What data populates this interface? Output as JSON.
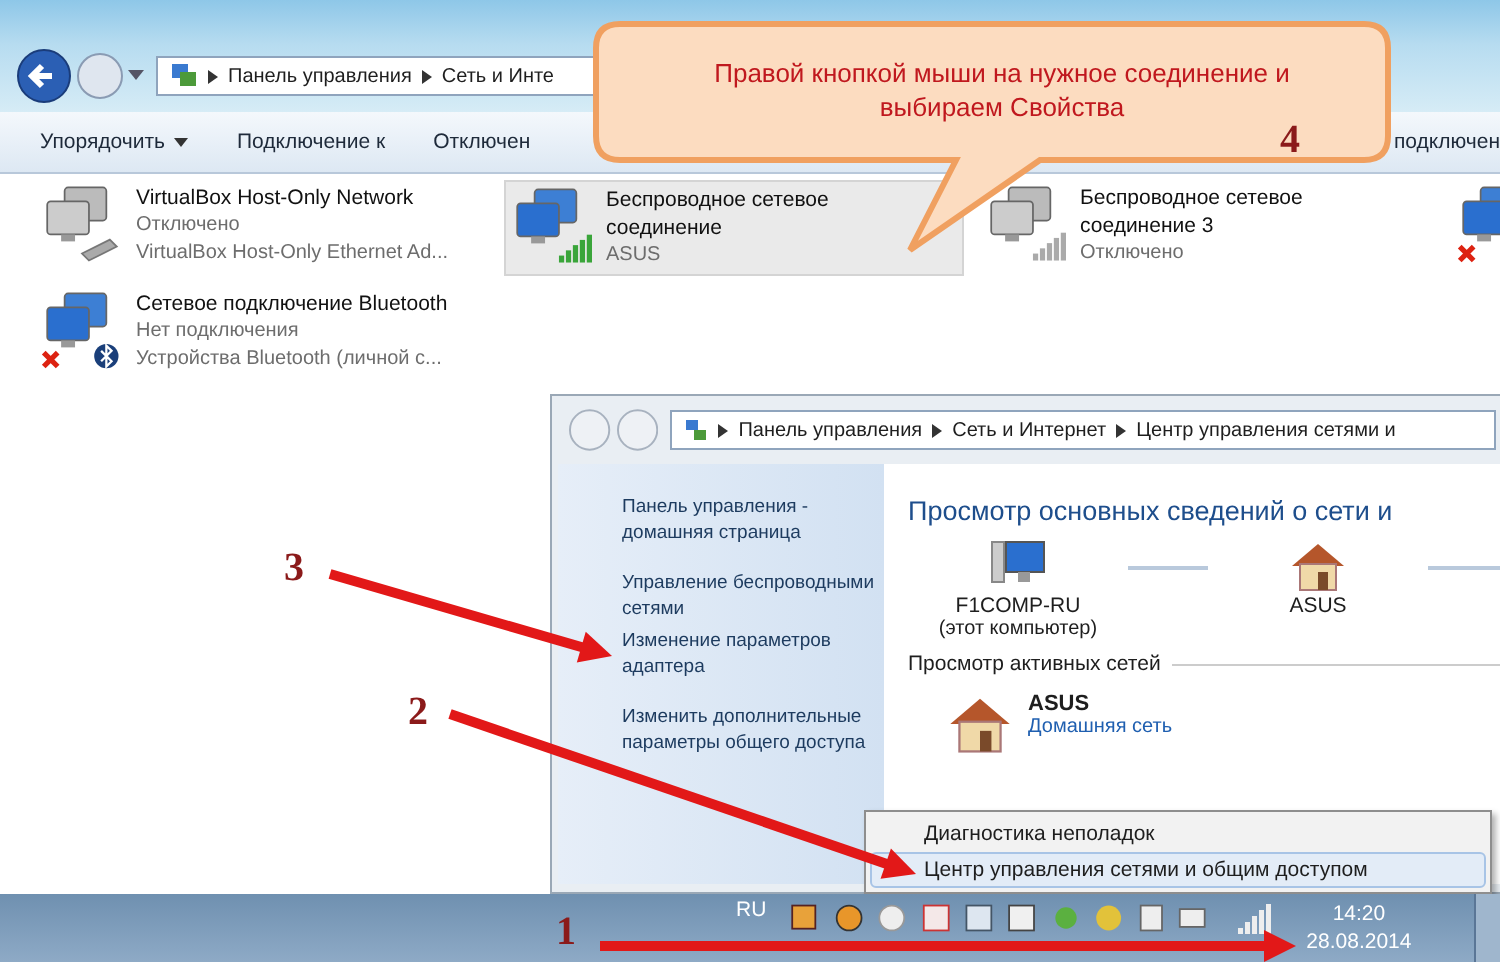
{
  "explorer": {
    "breadcrumb": [
      "Панель управления",
      "Сеть и Инте"
    ],
    "toolbar": [
      {
        "label": "Упорядочить",
        "dropdown": true
      },
      {
        "label": "Подключение к",
        "dropdown": false
      },
      {
        "label": "Отключен",
        "dropdown": false
      },
      {
        "label": "подключен",
        "dropdown": false
      }
    ],
    "adapters": [
      {
        "kind": "ethernet",
        "disabled": true,
        "disconnected": false,
        "selected": false,
        "name": "VirtualBox Host-Only Network",
        "status": "Отключено",
        "device": "VirtualBox Host-Only Ethernet Ad..."
      },
      {
        "kind": "wireless",
        "disabled": false,
        "disconnected": false,
        "selected": true,
        "name": "Беспроводное сетевое соединение",
        "status": "ASUS"
      },
      {
        "kind": "wireless",
        "disabled": true,
        "disconnected": false,
        "selected": false,
        "name": "Беспроводное сетевое соединение 3",
        "status": "Отключено"
      },
      {
        "kind": "ethernet",
        "disabled": false,
        "disconnected": true,
        "selected": false
      },
      {
        "kind": "bluetooth",
        "disabled": false,
        "disconnected": true,
        "selected": false,
        "name": "Сетевое подключение Bluetooth",
        "status": "Нет подключения",
        "device": "Устройства Bluetooth (личной с..."
      }
    ]
  },
  "callout": {
    "text": "Правой кнопкой мыши на нужное соединение и выбираем Свойства"
  },
  "network_center": {
    "breadcrumb": [
      "Панель управления",
      "Сеть и Интернет",
      "Центр управления сетями и"
    ],
    "side_links": [
      "Панель управления - домашняя страница",
      "Управление беспроводными сетями",
      "Изменение параметров адаптера",
      "Изменить дополнительные параметры общего доступа"
    ],
    "heading": "Просмотр основных сведений о сети и",
    "map": [
      {
        "kind": "computer",
        "label": "F1COMP-RU",
        "sublabel": "(этот компьютер)"
      },
      {
        "kind": "house",
        "label": "ASUS"
      }
    ],
    "active_title": "Просмотр активных сетей",
    "active_network": {
      "name": "ASUS",
      "type": "Домашняя сеть"
    }
  },
  "context_menu": [
    {
      "label": "Диагностика неполадок",
      "selected": false
    },
    {
      "label": "Центр управления сетями и общим доступом",
      "selected": true
    }
  ],
  "taskbar": {
    "language": "RU",
    "time": "14:20",
    "date": "28.08.2014"
  },
  "annotations": [
    {
      "label": "1"
    },
    {
      "label": "2"
    },
    {
      "label": "3"
    },
    {
      "label": "4"
    }
  ]
}
